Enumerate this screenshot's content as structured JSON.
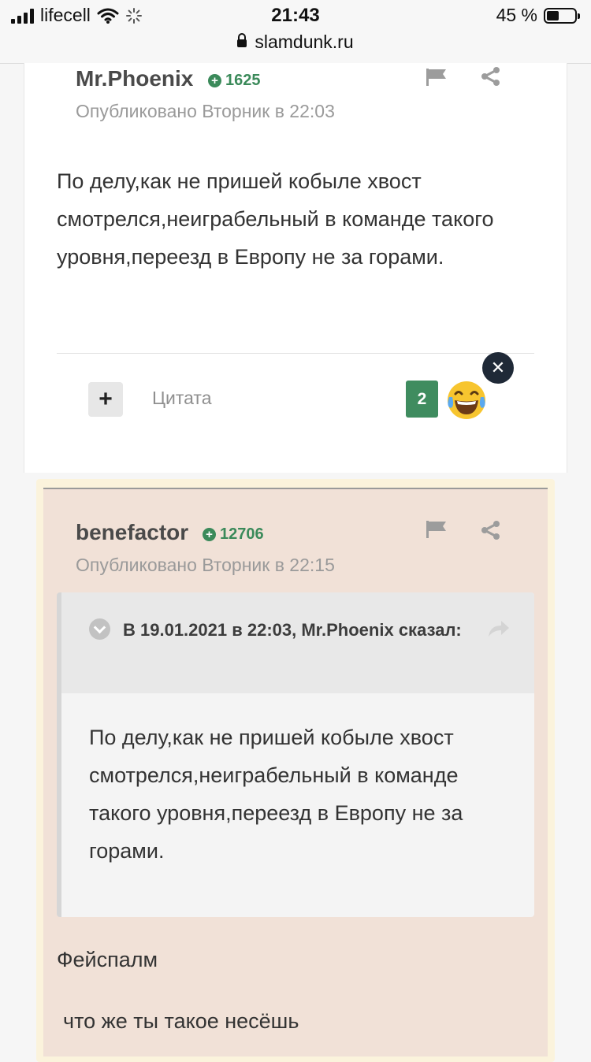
{
  "status_bar": {
    "carrier": "lifecell",
    "time": "21:43",
    "battery": "45 %",
    "battery_level": 0.45,
    "url": "slamdunk.ru"
  },
  "posts": [
    {
      "author": "Mr.Phoenix",
      "reputation": "1625",
      "published": "Опубликовано Вторник в 22:03",
      "body": "По делу,как не пришей кобыле хвост смотрелся,неиграбельный в команде такого уровня,переезд в Европу не за горами.",
      "quote_label": "Цитата",
      "reaction_count": "2",
      "reaction_emoji": "😂",
      "close_label": "✕"
    },
    {
      "author": "benefactor",
      "reputation": "12706",
      "published": "Опубликовано Вторник в 22:15",
      "quote": {
        "meta": "В 19.01.2021 в 22:03, Mr.Phoenix сказал:",
        "text": "По делу,как не пришей кобыле хвост смотрелся,неиграбельный в команде такого уровня,переезд в Европу не за горами."
      },
      "line1": "Фейспалм",
      "line2": "что же ты такое несёшь"
    }
  ],
  "icons": {
    "flag": "flag-icon",
    "share": "share-icon",
    "plus": "plus-icon",
    "close": "close-icon",
    "chevron": "chevron-down-icon",
    "reply": "reply-arrow-icon"
  },
  "colors": {
    "reputation_green": "#3b8a5a",
    "reaction_green": "#3f8c5f",
    "highlight_bg": "#f1e1d7"
  }
}
